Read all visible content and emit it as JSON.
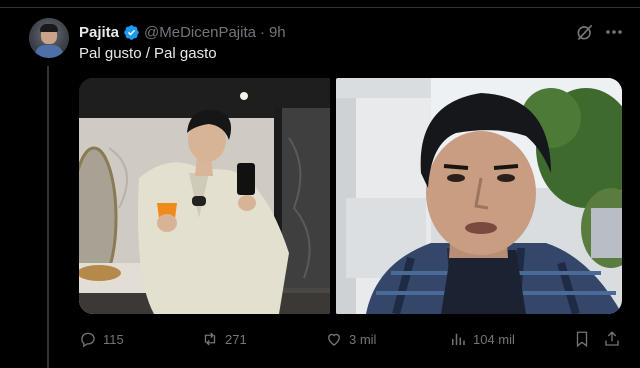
{
  "tweet": {
    "author_name": "Pajita",
    "handle": "@MeDicenPajita",
    "separator": "·",
    "time": "9h",
    "text": "Pal gusto / Pal gasto"
  },
  "media": [
    {
      "description_icon": "mirror-selfie-photo"
    },
    {
      "description_icon": "street-face-photo"
    }
  ],
  "actions": {
    "replies": "115",
    "reposts": "271",
    "likes": "3 mil",
    "views": "104 mil"
  },
  "colors": {
    "background": "#000000",
    "text": "#e7e9ea",
    "muted": "#71767b",
    "verified": "#1d9bf0",
    "divider": "#2f3336"
  }
}
